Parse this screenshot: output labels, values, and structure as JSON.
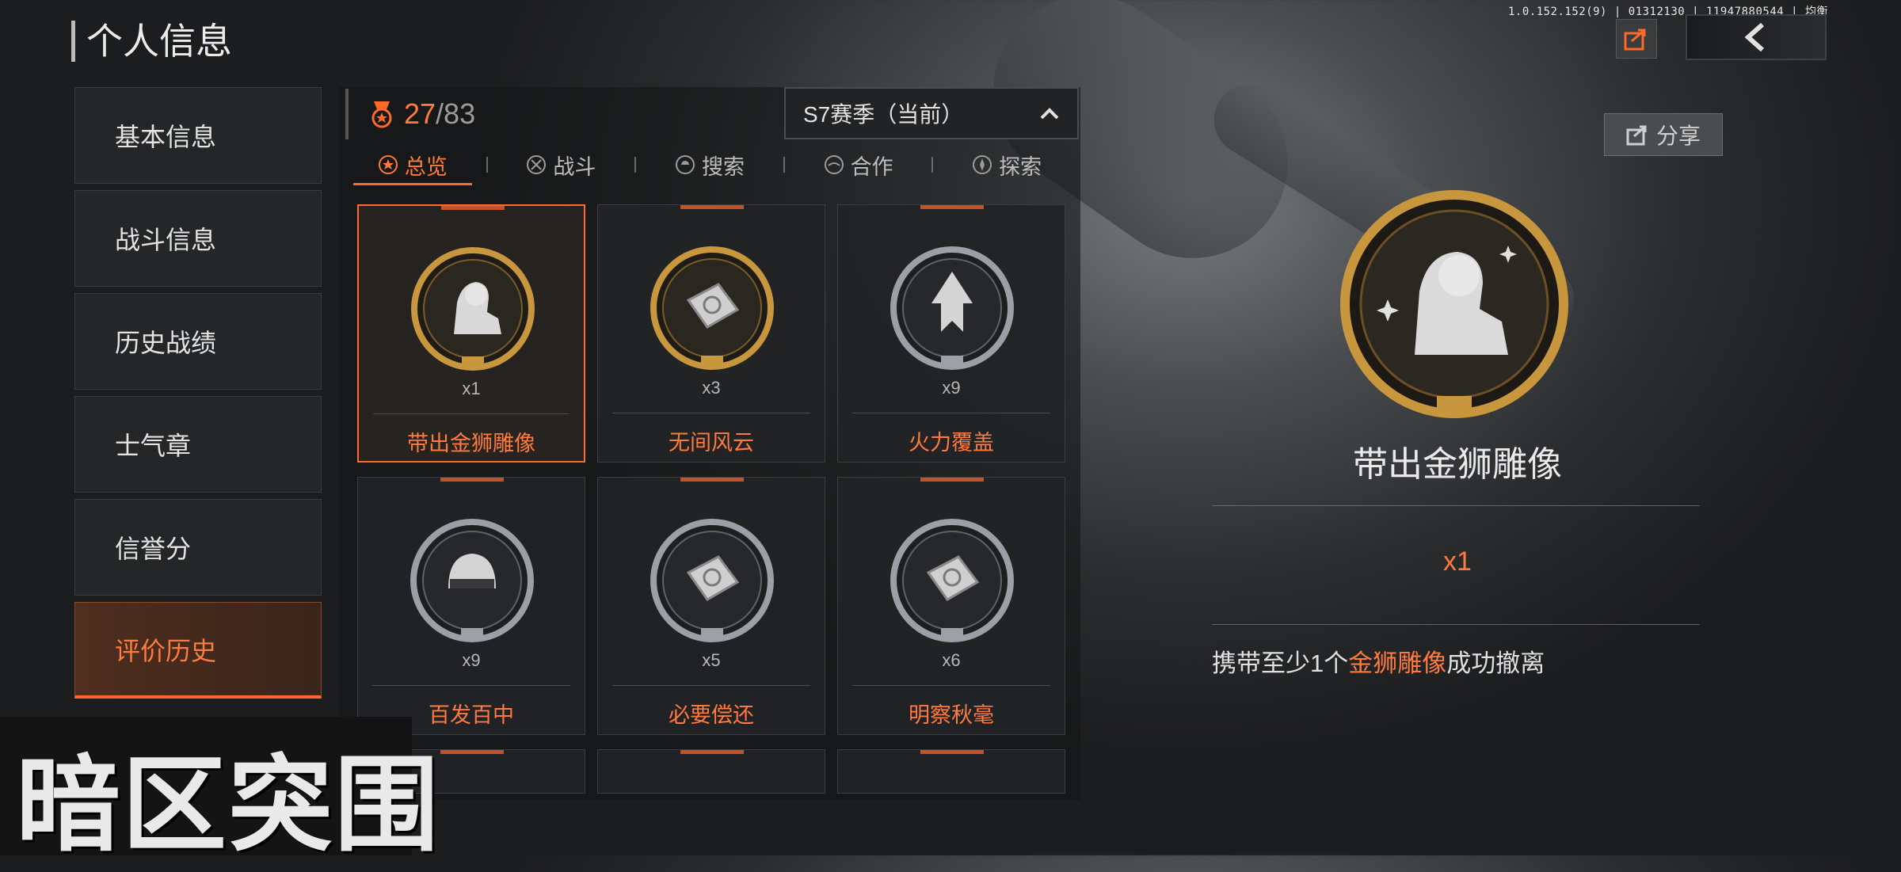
{
  "debug_text": "1.0.152.152(9) | 01312130 | 11947880544 | 均衡",
  "page_title": "个人信息",
  "share_label": "分享",
  "nav": [
    {
      "label": "基本信息"
    },
    {
      "label": "战斗信息"
    },
    {
      "label": "历史战绩"
    },
    {
      "label": "士气章"
    },
    {
      "label": "信誉分"
    },
    {
      "label": "评价历史"
    }
  ],
  "progress": {
    "current": "27",
    "total": "/83"
  },
  "season": {
    "selected": "S7赛季（当前）"
  },
  "tabs": [
    {
      "label": "总览"
    },
    {
      "label": "战斗"
    },
    {
      "label": "搜索"
    },
    {
      "label": "合作"
    },
    {
      "label": "探索"
    }
  ],
  "medals": [
    {
      "name": "带出金狮雕像",
      "count": "x1",
      "tier": "gold",
      "icon": "lion-icon"
    },
    {
      "name": "无间风云",
      "count": "x3",
      "tier": "gold",
      "icon": "chip-icon"
    },
    {
      "name": "火力覆盖",
      "count": "x9",
      "tier": "silver",
      "icon": "rocket-icon"
    },
    {
      "name": "百发百中",
      "count": "x9",
      "tier": "silver",
      "icon": "helmet-icon"
    },
    {
      "name": "必要偿还",
      "count": "x5",
      "tier": "silver",
      "icon": "chip-icon"
    },
    {
      "name": "明察秋毫",
      "count": "x6",
      "tier": "silver",
      "icon": "chip-icon"
    }
  ],
  "detail": {
    "name": "带出金狮雕像",
    "count": "x1",
    "desc_before": "携带至少1个",
    "desc_highlight": "金狮雕像",
    "desc_after": "成功撤离"
  },
  "logo_text": "暗区突围",
  "colors": {
    "accent": "#ff7a3d",
    "gold": "#c8963c",
    "silver": "#9aa0a6"
  }
}
